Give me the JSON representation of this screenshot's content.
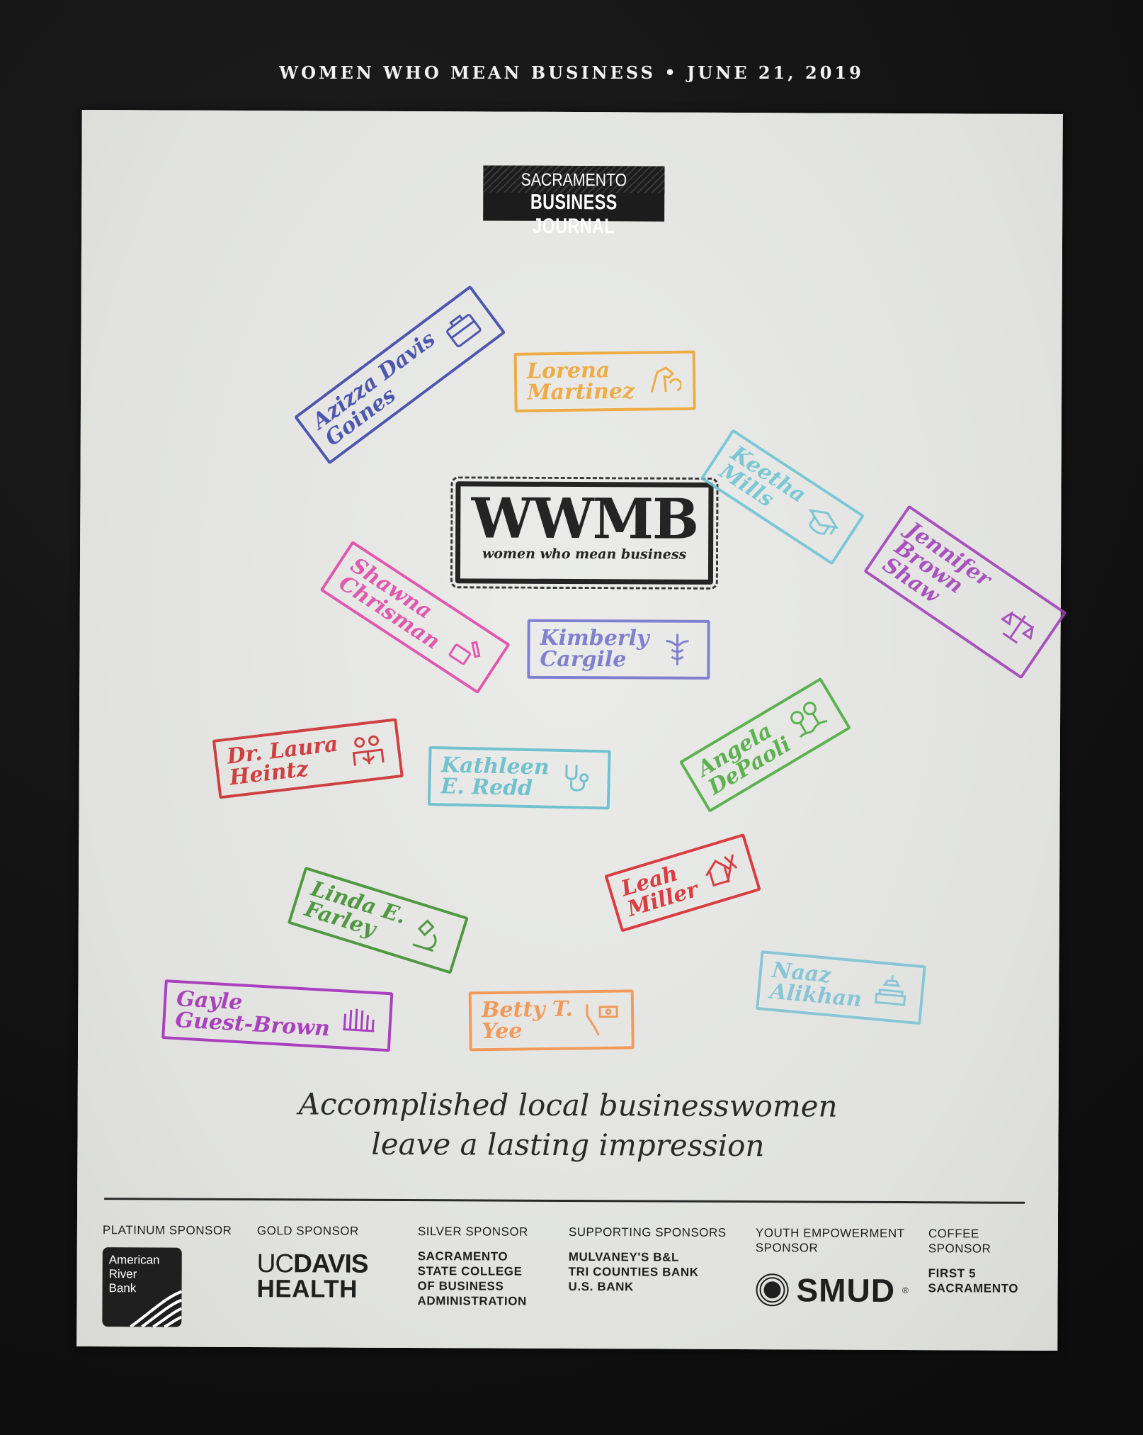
{
  "header": {
    "issue_line": "WOMEN WHO MEAN BUSINESS • JUNE 21, 2019"
  },
  "masthead": {
    "line1": "SACRAMENTO",
    "line2": "BUSINESS JOURNAL"
  },
  "logo": {
    "acronym": "WWMB",
    "subtitle": "women who mean business"
  },
  "honorees": [
    {
      "name": "Azizza Davis\nGoines",
      "color": "#3b43a8",
      "icon": "briefcase-icon"
    },
    {
      "name": "Lorena\nMartinez",
      "color": "#f0a330",
      "icon": "horse-icon"
    },
    {
      "name": "Keetha\nMills",
      "color": "#6fc3d3",
      "icon": "graduation-cap-icon"
    },
    {
      "name": "Jennifer\nBrown Shaw",
      "color": "#a040b8",
      "icon": "scales-icon"
    },
    {
      "name": "Shawna\nChrisman",
      "color": "#e046a8",
      "icon": "paint-icon"
    },
    {
      "name": "Kimberly\nCargile",
      "color": "#7272cc",
      "icon": "caduceus-icon"
    },
    {
      "name": "Angela\nDePaoli",
      "color": "#4aaa3c",
      "icon": "trees-icon"
    },
    {
      "name": "Dr. Laura\nHeintz",
      "color": "#cc2a2a",
      "icon": "family-icon"
    },
    {
      "name": "Kathleen\nE. Redd",
      "color": "#62bccc",
      "icon": "stethoscope-icon"
    },
    {
      "name": "Leah\nMiller",
      "color": "#d8262c",
      "icon": "house-tools-icon"
    },
    {
      "name": "Linda E.\nFarley",
      "color": "#3d8e2e",
      "icon": "microscope-icon"
    },
    {
      "name": "Naaz\nAlikhan",
      "color": "#7cc2d4",
      "icon": "sofa-lamp-icon"
    },
    {
      "name": "Gayle\nGuest-Brown",
      "color": "#a22ab8",
      "icon": "hands-icon"
    },
    {
      "name": "Betty T.\nYee",
      "color": "#f39048",
      "icon": "california-money-icon"
    }
  ],
  "tagline": {
    "line1": "Accomplished local businesswomen",
    "line2": "leave a lasting impression"
  },
  "sponsors": {
    "platinum": {
      "label": "PLATINUM SPONSOR",
      "logo_text": "American\nRiver\nBank"
    },
    "gold": {
      "label": "GOLD SPONSOR",
      "logo_line1a": "UC",
      "logo_line1b": "DAVIS",
      "logo_line2": "HEALTH"
    },
    "silver": {
      "label": "SILVER SPONSOR",
      "names": "SACRAMENTO\nSTATE COLLEGE\nOF BUSINESS\nADMINISTRATION"
    },
    "supporting": {
      "label": "SUPPORTING SPONSORS",
      "names": "MULVANEY'S B&L\nTRI COUNTIES BANK\nU.S. BANK"
    },
    "youth": {
      "label": "YOUTH EMPOWERMENT\nSPONSOR",
      "logo_text": "SMUD",
      "reg": "®"
    },
    "coffee": {
      "label": "COFFEE\nSPONSOR",
      "names": "FIRST 5\nSACRAMENTO"
    }
  }
}
